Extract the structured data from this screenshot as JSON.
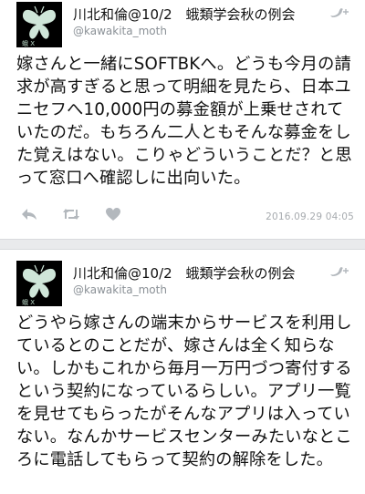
{
  "tweets": [
    {
      "display_name": "川北和倫@10/2",
      "display_name_extra": "蛾類学会秋の例会",
      "handle": "@kawakita_moth",
      "text": "嫁さんと一緒にSOFTBKへ。どうも今月の請求が高すぎると思って明細を見たら、日本ユニセフへ10,000円の募金額が上乗せされていたのだ。もちろん二人ともそんな募金をした覚えはない。こりゃどういうことだ？と思って窓口へ確認しに出向いた。",
      "timestamp": "2016.09.29 04:05"
    },
    {
      "display_name": "川北和倫@10/2",
      "display_name_extra": "蛾類学会秋の例会",
      "handle": "@kawakita_moth",
      "text": "どうやら嫁さんの端末からサービスを利用しているとのことだが、嫁さんは全く知らない。しかもこれから毎月一万円づつ寄付するという契約になっているらしい。アプリ一覧を見せてもらったがそんなアプリは入っていない。なんかサービスセンターみたいなところに電話してもらって契約の解除をした。",
      "timestamp": ""
    }
  ],
  "icons": {
    "avatar": "moth-avatar-icon",
    "follow": "bird-follow-icon",
    "reply": "reply-icon",
    "retweet": "retweet-icon",
    "like": "heart-icon"
  },
  "colors": {
    "muted": "#8a9096",
    "icon": "#b3b8bd",
    "divider": "#e9eaec"
  }
}
